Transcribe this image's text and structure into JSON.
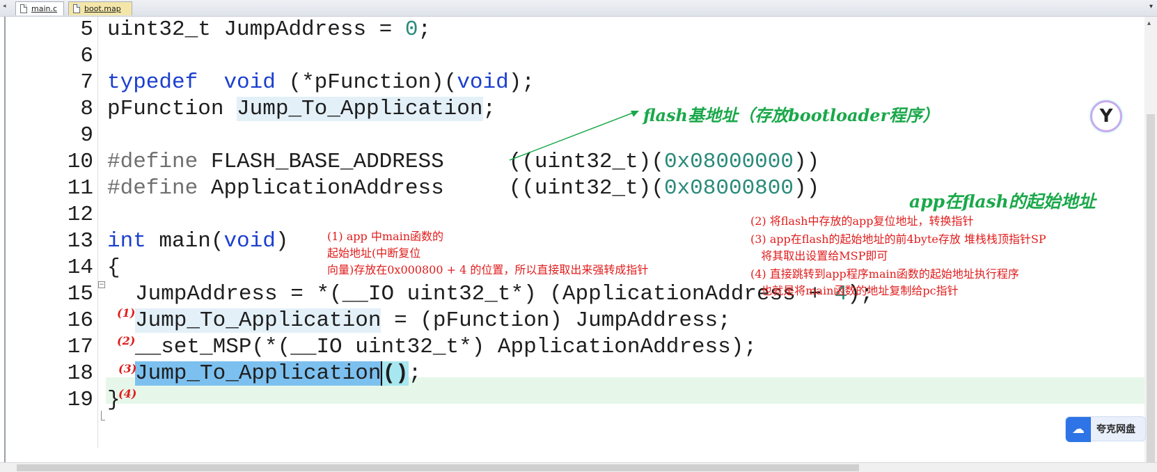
{
  "tabs": [
    {
      "label": "main.c",
      "active": true
    },
    {
      "label": "boot.map",
      "active": false
    }
  ],
  "code_lines": [
    {
      "num": "5"
    },
    {
      "num": "6"
    },
    {
      "num": "7"
    },
    {
      "num": "8"
    },
    {
      "num": "9"
    },
    {
      "num": "10"
    },
    {
      "num": "11"
    },
    {
      "num": "12"
    },
    {
      "num": "13"
    },
    {
      "num": "14"
    },
    {
      "num": "15"
    },
    {
      "num": "16"
    },
    {
      "num": "17"
    },
    {
      "num": "18"
    },
    {
      "num": "19"
    }
  ],
  "code": {
    "l5_a": "uint32_t JumpAddress = ",
    "l5_num": "0",
    "l5_b": ";",
    "l7_kw1": "typedef",
    "l7_sp": "  ",
    "l7_kw2": "void",
    "l7_mid": " (*pFunction)(",
    "l7_kw3": "void",
    "l7_end": ");",
    "l8_a": "pFunction ",
    "l8_hl": "Jump_To_Application",
    "l8_b": ";",
    "l10_pp": "#define",
    "l10_a": " FLASH_BASE_ADDRESS     ((uint32_t)(",
    "l10_num": "0x08000000",
    "l10_b": "))",
    "l11_pp": "#define",
    "l11_a": " ApplicationAddress     ((uint32_t)(",
    "l11_num": "0x08000800",
    "l11_b": "))",
    "l13_kw": "int",
    "l13_a": " main(",
    "l13_kw2": "void",
    "l13_b": ")",
    "l14": "{",
    "l15_a": "JumpAddress = *(__IO uint32_t*) (ApplicationAddress + ",
    "l15_num": "4",
    "l15_b": ");",
    "l16_hl": "Jump_To_Application",
    "l16_a": " = (pFunction) JumpAddress;",
    "l17": "__set_MSP(*(__IO uint32_t*) ApplicationAddress);",
    "l18_sel": "Jump_To_Application",
    "l18_paren": "()",
    "l18_end": ";",
    "l19": "}"
  },
  "markers": [
    "(1)",
    "(2)",
    "(3)",
    "(4)"
  ],
  "annotations": {
    "flash_base": "flash基地址（存放bootloader程序）",
    "app_start": "app在flash的起始地址",
    "note1": "(1) app 中main函数的\n起始地址(中断复位\n向量)存放在0x000800 + 4 的位置，所以直接取出来强转成指针",
    "note2": "(2) 将flash中存放的app复位地址，转换指针",
    "note3": "(3) app在flash的起始地址的前4byte存放 堆栈栈顶指针SP\n   将其取出设置给MSP即可",
    "note4": "(4) 直接跳转到app程序main函数的起始地址执行程序\n   也就是将main函数的地址复制给pc指针"
  },
  "widgets": {
    "quark_label": "夸克网盘",
    "logo_icon": "yuque-logo-icon",
    "cloud_icon": "cloud-icon"
  },
  "colors": {
    "keyword": "#1b3fcf",
    "number": "#2a8a7a",
    "annotation_green": "#1aa84a",
    "annotation_red": "#e01c1c",
    "selection": "#7cc0ef"
  }
}
